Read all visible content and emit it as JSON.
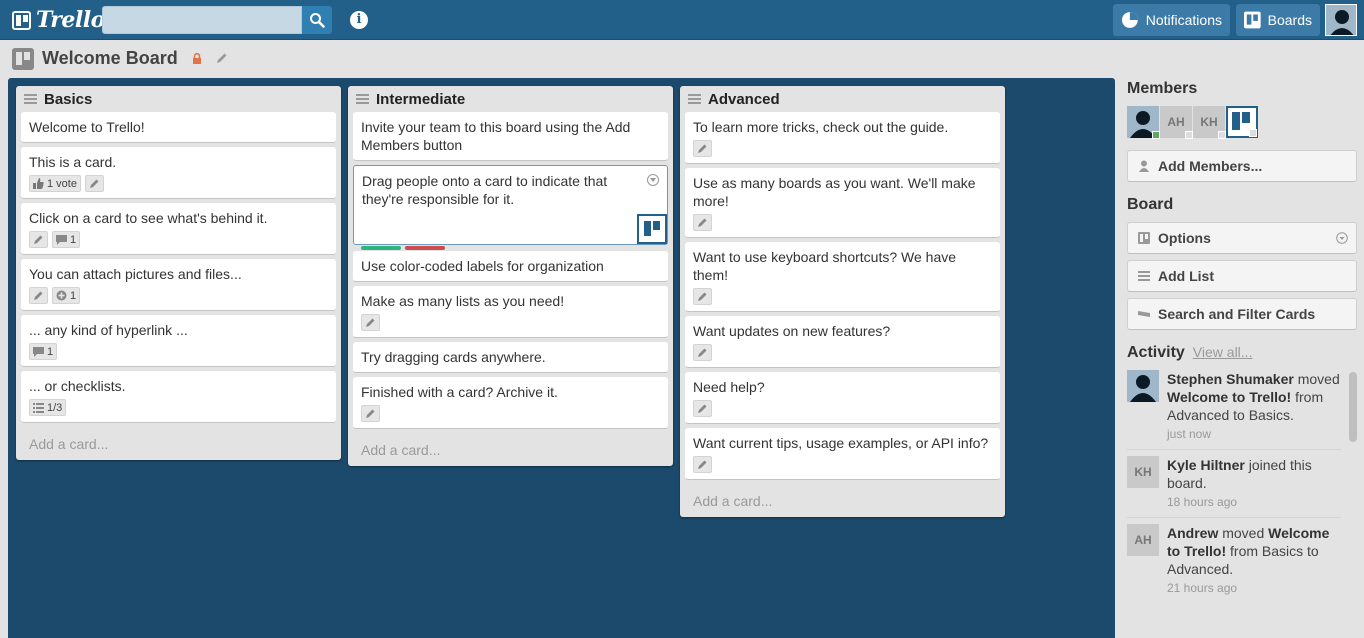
{
  "header": {
    "logo_text": "Trello",
    "search": {
      "value": "",
      "placeholder": ""
    },
    "notifications_label": "Notifications",
    "boards_label": "Boards",
    "info_glyph": "i"
  },
  "board": {
    "title": "Welcome Board",
    "icons": [
      "board-icon",
      "lock-icon",
      "pencil-icon"
    ]
  },
  "lists": [
    {
      "title": "Basics",
      "cards": [
        {
          "text": "Welcome to Trello!"
        },
        {
          "text": "This is a card.",
          "badges": [
            {
              "icon": "thumbs-up-icon",
              "text": "1 vote"
            },
            {
              "icon": "pencil-icon",
              "text": ""
            }
          ]
        },
        {
          "text": "Click on a card to see what's behind it.",
          "badges": [
            {
              "icon": "pencil-icon",
              "text": ""
            },
            {
              "icon": "comment-icon",
              "text": "1"
            }
          ]
        },
        {
          "text": "You can attach pictures and files...",
          "badges": [
            {
              "icon": "pencil-icon",
              "text": ""
            },
            {
              "icon": "attachment-icon",
              "text": "1"
            }
          ]
        },
        {
          "text": "... any kind of hyperlink ...",
          "badges": [
            {
              "icon": "comment-icon",
              "text": "1"
            }
          ]
        },
        {
          "text": "... or checklists.",
          "badges": [
            {
              "icon": "checklist-icon",
              "text": "1/3"
            }
          ]
        }
      ],
      "add_card": "Add a card..."
    },
    {
      "title": "Intermediate",
      "cards": [
        {
          "text": "Invite your team to this board using the Add Members button"
        },
        {
          "text": "Drag people onto a card to indicate that they're responsible for it."
        },
        {
          "text": "Use color-coded labels for organization",
          "labels": [
            "#34b27d",
            "#cb4d4d"
          ]
        },
        {
          "text": "Make as many lists as you need!",
          "badges": [
            {
              "icon": "pencil-icon",
              "text": ""
            }
          ]
        },
        {
          "text": "Try dragging cards anywhere."
        },
        {
          "text": "Finished with a card? Archive it.",
          "badges": [
            {
              "icon": "pencil-icon",
              "text": ""
            }
          ]
        }
      ],
      "add_card": "Add a card..."
    },
    {
      "title": "Advanced",
      "cards": [
        {
          "text": "To learn more tricks, check out the guide.",
          "badges": [
            {
              "icon": "pencil-icon",
              "text": ""
            }
          ]
        },
        {
          "text": "Use as many boards as you want. We'll make more!",
          "badges": [
            {
              "icon": "pencil-icon",
              "text": ""
            }
          ]
        },
        {
          "text": "Want to use keyboard shortcuts? We have them!",
          "badges": [
            {
              "icon": "pencil-icon",
              "text": ""
            }
          ]
        },
        {
          "text": "Want updates on new features?",
          "badges": [
            {
              "icon": "pencil-icon",
              "text": ""
            }
          ]
        },
        {
          "text": "Need help?",
          "badges": [
            {
              "icon": "pencil-icon",
              "text": ""
            }
          ]
        },
        {
          "text": "Want current tips, usage examples, or API info?",
          "badges": [
            {
              "icon": "pencil-icon",
              "text": ""
            }
          ]
        }
      ],
      "add_card": "Add a card..."
    }
  ],
  "sidebar": {
    "members_heading": "Members",
    "members": [
      {
        "initials": ""
      },
      {
        "initials": "AH"
      },
      {
        "initials": "KH"
      },
      {
        "initials": ""
      }
    ],
    "add_members_label": "Add Members...",
    "board_heading": "Board",
    "options_label": "Options",
    "add_list_label": "Add List",
    "search_filter_label": "Search and Filter Cards",
    "activity_heading": "Activity",
    "view_all_label": "View all...",
    "activity": [
      {
        "avatar": "",
        "who": "Stephen Shumaker",
        "pre": " moved ",
        "what": "Welcome to Trello!",
        "post": " from Advanced to Basics.",
        "time": "just now"
      },
      {
        "avatar": "KH",
        "who": "Kyle Hiltner",
        "pre": " joined this board.",
        "what": "",
        "post": "",
        "time": "18 hours ago"
      },
      {
        "avatar": "AH",
        "who": "Andrew",
        "pre": " moved ",
        "what": "Welcome to Trello!",
        "post": " from Basics to Advanced.",
        "time": "21 hours ago"
      }
    ]
  },
  "colors": {
    "header": "#226089",
    "canvas": "#1b4a6c",
    "label_green": "#34b27d",
    "label_red": "#cb4d4d"
  }
}
